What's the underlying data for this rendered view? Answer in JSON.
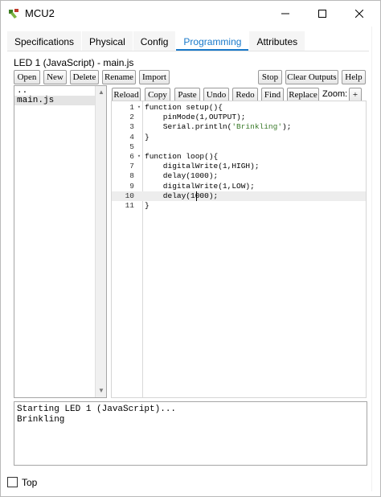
{
  "window": {
    "title": "MCU2",
    "icon": "cisco-mcu-icon",
    "controls": [
      "minimize-icon",
      "maximize-icon",
      "close-icon"
    ]
  },
  "tabs": [
    {
      "label": "Specifications",
      "active": false
    },
    {
      "label": "Physical",
      "active": false
    },
    {
      "label": "Config",
      "active": false
    },
    {
      "label": "Programming",
      "active": true
    },
    {
      "label": "Attributes",
      "active": false
    }
  ],
  "project_title": "LED 1 (JavaScript) - main.js",
  "project_toolbar": {
    "open": "Open",
    "new": "New",
    "delete": "Delete",
    "rename": "Rename",
    "import": "Import",
    "stop": "Stop",
    "clear_outputs": "Clear Outputs",
    "help": "Help"
  },
  "editor_toolbar": {
    "reload": "Reload",
    "copy": "Copy",
    "paste": "Paste",
    "undo": "Undo",
    "redo": "Redo",
    "find": "Find",
    "replace": "Replace",
    "zoom_label": "Zoom:",
    "zoom_plus": "+"
  },
  "files": [
    "..",
    "main.js"
  ],
  "selected_file": "main.js",
  "code_lines": [
    {
      "n": "1",
      "fold": "▾",
      "text": "function setup(){"
    },
    {
      "n": "2",
      "fold": "",
      "text": "    pinMode(1,OUTPUT);"
    },
    {
      "n": "3",
      "fold": "",
      "text": "    Serial.println(",
      "str": "'Brinkling'",
      "tail": ");"
    },
    {
      "n": "4",
      "fold": "",
      "text": "}"
    },
    {
      "n": "5",
      "fold": "",
      "text": ""
    },
    {
      "n": "6",
      "fold": "▾",
      "text": "function loop(){"
    },
    {
      "n": "7",
      "fold": "",
      "text": "    digitalWrite(1,HIGH);"
    },
    {
      "n": "8",
      "fold": "",
      "text": "    delay(1000);"
    },
    {
      "n": "9",
      "fold": "",
      "text": "    digitalWrite(1,LOW);"
    },
    {
      "n": "10",
      "fold": "",
      "text": "    delay(1000);"
    },
    {
      "n": "11",
      "fold": "",
      "text": "}"
    }
  ],
  "current_line": 10,
  "console_lines": [
    "Starting LED 1 (JavaScript)...",
    "Brinkling"
  ],
  "always_on_top_label": "Top",
  "colors": {
    "accent": "#1979ca",
    "string": "#3a7a2a",
    "current_line": "#ededed"
  }
}
